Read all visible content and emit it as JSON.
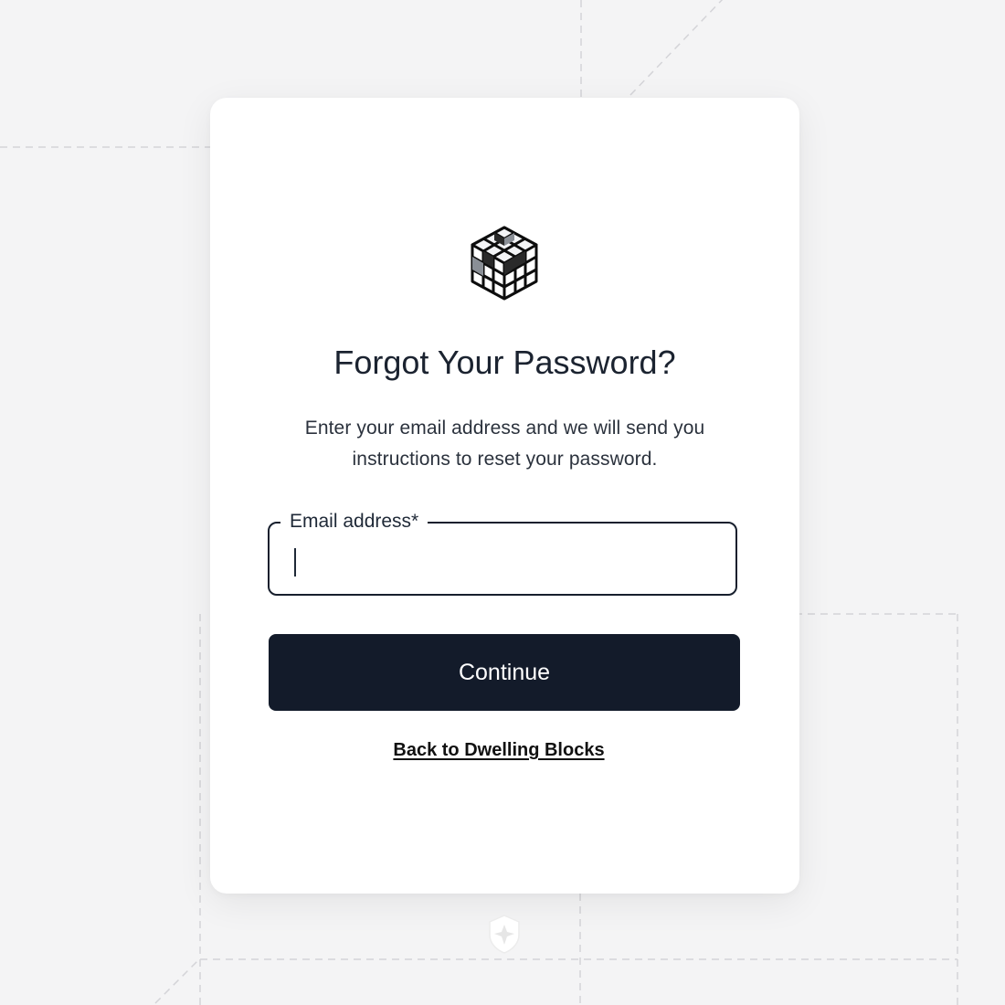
{
  "card": {
    "title": "Forgot Your Password?",
    "description": "Enter your email address and we will send you instructions to reset your password.",
    "email_field": {
      "label": "Email address*",
      "value": ""
    },
    "continue_label": "Continue",
    "back_link_label": "Back to Dwelling Blocks"
  },
  "icons": {
    "logo": "cube-grid-logo-icon",
    "footer": "shield-icon"
  },
  "colors": {
    "primary_button": "#131b2a",
    "card_background": "#ffffff",
    "page_background": "#f4f4f5",
    "text_primary": "#1b2330"
  }
}
